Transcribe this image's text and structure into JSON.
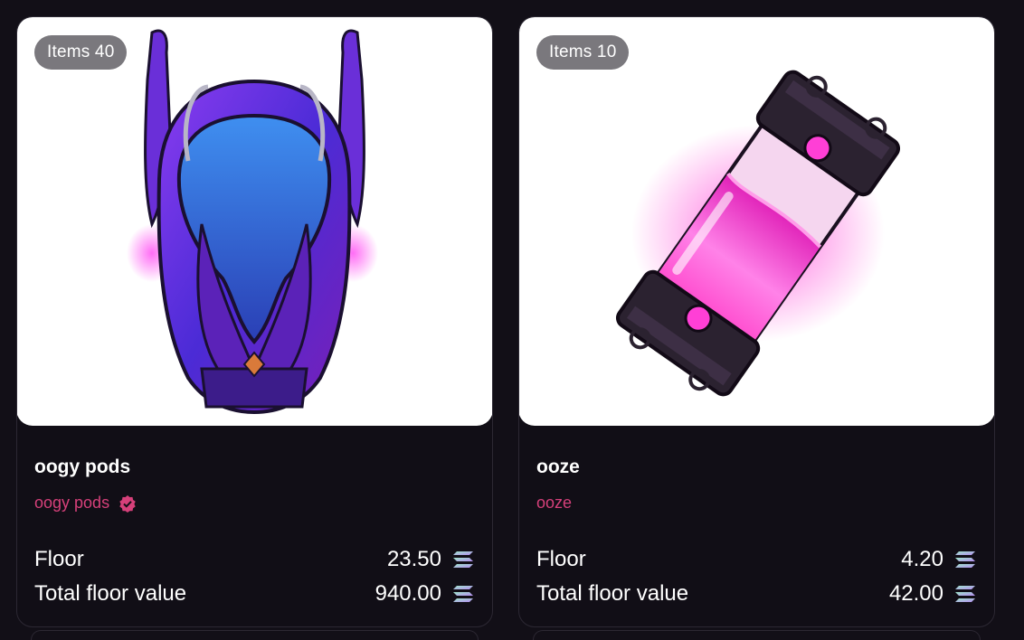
{
  "cards": [
    {
      "items_badge": "Items 40",
      "title": "oogy pods",
      "collection": "oogy pods",
      "verified": true,
      "floor_label": "Floor",
      "floor_value": "23.50",
      "total_label": "Total floor value",
      "total_value": "940.00",
      "currency_icon": "solana-icon"
    },
    {
      "items_badge": "Items 10",
      "title": "ooze",
      "collection": "ooze",
      "verified": false,
      "floor_label": "Floor",
      "floor_value": "4.20",
      "total_label": "Total floor value",
      "total_value": "42.00",
      "currency_icon": "solana-icon"
    }
  ],
  "colors": {
    "background": "#120f17",
    "collection_accent": "#d6407a",
    "badge": "#7a787d"
  }
}
